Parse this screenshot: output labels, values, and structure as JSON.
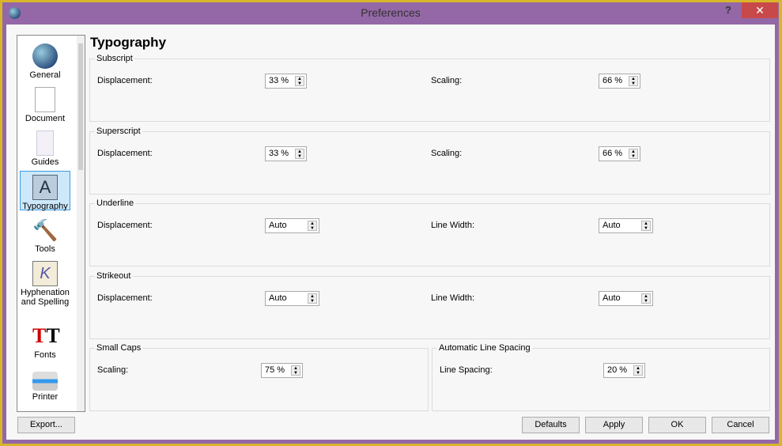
{
  "window": {
    "title": "Preferences",
    "help": "?",
    "close": "✕"
  },
  "sidebar": {
    "items": [
      {
        "label": "General",
        "icon": "globe-icon"
      },
      {
        "label": "Document",
        "icon": "document-icon"
      },
      {
        "label": "Guides",
        "icon": "guides-icon"
      },
      {
        "label": "Typography",
        "icon": "typography-icon",
        "selected": true
      },
      {
        "label": "Tools",
        "icon": "hammer-icon"
      },
      {
        "label": "Hyphenation and Spelling",
        "icon": "pen-icon"
      },
      {
        "label": "Fonts",
        "icon": "fonts-icon"
      },
      {
        "label": "Printer",
        "icon": "printer-icon"
      }
    ]
  },
  "page": {
    "title": "Typography",
    "subscript": {
      "label": "Subscript",
      "displacement_label": "Displacement:",
      "displacement": "33 %",
      "scaling_label": "Scaling:",
      "scaling": "66 %"
    },
    "superscript": {
      "label": "Superscript",
      "displacement_label": "Displacement:",
      "displacement": "33 %",
      "scaling_label": "Scaling:",
      "scaling": "66 %"
    },
    "underline": {
      "label": "Underline",
      "displacement_label": "Displacement:",
      "displacement": "Auto",
      "width_label": "Line Width:",
      "width": "Auto"
    },
    "strikeout": {
      "label": "Strikeout",
      "displacement_label": "Displacement:",
      "displacement": "Auto",
      "width_label": "Line Width:",
      "width": "Auto"
    },
    "smallcaps": {
      "label": "Small Caps",
      "scaling_label": "Scaling:",
      "scaling": "75 %"
    },
    "linespacing": {
      "label": "Automatic Line Spacing",
      "spacing_label": "Line Spacing:",
      "spacing": "20 %"
    }
  },
  "buttons": {
    "export": "Export...",
    "defaults": "Defaults",
    "apply": "Apply",
    "ok": "OK",
    "cancel": "Cancel"
  },
  "colors": {
    "titlebar": "#9467a6",
    "border": "#d8b62c",
    "close": "#c8494a",
    "selection": "#cde8fb"
  }
}
